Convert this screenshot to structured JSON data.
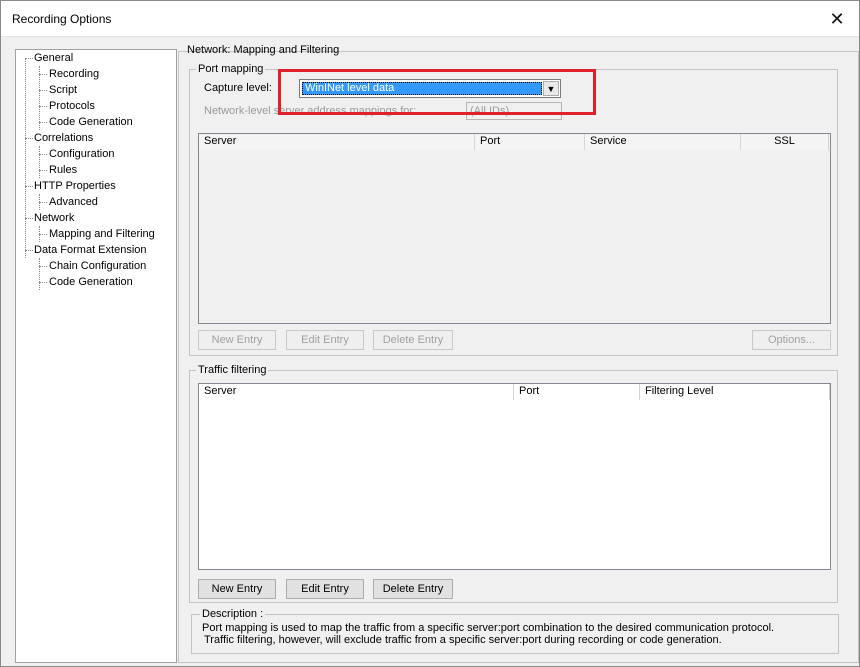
{
  "window": {
    "title": "Recording Options",
    "close_glyph": "✕"
  },
  "tree": [
    {
      "label": "General",
      "level": 0
    },
    {
      "label": "Recording",
      "level": 1
    },
    {
      "label": "Script",
      "level": 1
    },
    {
      "label": "Protocols",
      "level": 1
    },
    {
      "label": "Code Generation",
      "level": 1
    },
    {
      "label": "Correlations",
      "level": 0
    },
    {
      "label": "Configuration",
      "level": 1
    },
    {
      "label": "Rules",
      "level": 1
    },
    {
      "label": "HTTP Properties",
      "level": 0
    },
    {
      "label": "Advanced",
      "level": 1
    },
    {
      "label": "Network",
      "level": 0
    },
    {
      "label": "Mapping and Filtering",
      "level": 1
    },
    {
      "label": "Data Format Extension",
      "level": 0
    },
    {
      "label": "Chain Configuration",
      "level": 1
    },
    {
      "label": "Code Generation",
      "level": 1
    }
  ],
  "section_title": "Network: Mapping and Filtering",
  "port_mapping": {
    "group_label": "Port mapping",
    "capture_label": "Capture level:",
    "capture_value": "WinINet level data",
    "network_label": "Network-level server address mappings for:",
    "network_value": "(All IDs)",
    "columns": [
      "Server",
      "Port",
      "Service",
      "SSL"
    ],
    "buttons": {
      "new": "New Entry",
      "edit": "Edit Entry",
      "delete": "Delete Entry",
      "options": "Options..."
    }
  },
  "traffic_filtering": {
    "group_label": "Traffic filtering",
    "columns": [
      "Server",
      "Port",
      "Filtering Level"
    ],
    "buttons": {
      "new": "New Entry",
      "edit": "Edit Entry",
      "delete": "Delete Entry"
    }
  },
  "description": {
    "label": "Description :",
    "line1": "Port mapping is used to map the traffic from a specific server:port combination to the desired communication protocol.",
    "line2": "Traffic filtering, however, will exclude traffic from a specific server:port during recording or code generation."
  },
  "colors": {
    "highlight": "#e0202a",
    "selection": "#3399ff"
  }
}
